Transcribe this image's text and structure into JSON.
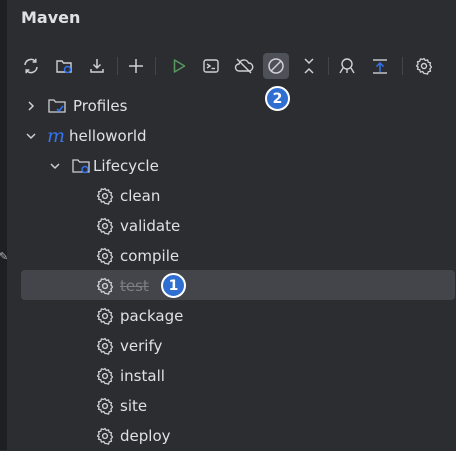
{
  "window": {
    "title": "Maven"
  },
  "toolbar": {
    "buttons": [
      {
        "icon": "reload-icon"
      },
      {
        "icon": "generate-sources-icon"
      },
      {
        "icon": "download-icon"
      },
      {
        "icon": "add-icon"
      },
      {
        "icon": "run-icon"
      },
      {
        "icon": "execute-goal-icon"
      },
      {
        "icon": "offline-mode-icon"
      },
      {
        "icon": "skip-tests-icon",
        "active": true
      },
      {
        "icon": "collapse-icon"
      },
      {
        "icon": "dependency-analyzer-icon"
      },
      {
        "icon": "show-effective-pom-icon"
      },
      {
        "icon": "settings-icon"
      }
    ]
  },
  "badges": [
    "1",
    "2"
  ],
  "tree": {
    "profiles": "Profiles",
    "project": "helloworld",
    "lifecycle": "Lifecycle",
    "phases": [
      {
        "label": "clean",
        "skipped": false
      },
      {
        "label": "validate",
        "skipped": false
      },
      {
        "label": "compile",
        "skipped": false
      },
      {
        "label": "test",
        "skipped": true,
        "selected": true
      },
      {
        "label": "package",
        "skipped": false
      },
      {
        "label": "verify",
        "skipped": false
      },
      {
        "label": "install",
        "skipped": false
      },
      {
        "label": "site",
        "skipped": false
      },
      {
        "label": "deploy",
        "skipped": false
      }
    ]
  },
  "colors": {
    "background": "#2b2d30",
    "accent": "#2f6fd1",
    "run": "#57965c",
    "maven": "#3574f0"
  }
}
